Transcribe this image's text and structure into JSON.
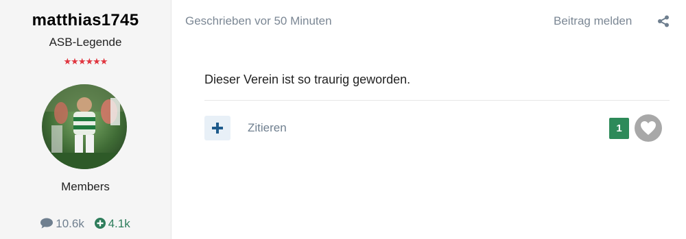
{
  "author": {
    "username": "matthias1745",
    "title": "ASB-Legende",
    "stars": "★★★★★★",
    "group": "Members",
    "post_count": "10.6k",
    "reputation": "4.1k"
  },
  "post": {
    "meta": "Geschrieben vor 50 Minuten",
    "report_label": "Beitrag melden",
    "content": "Dieser Verein ist so traurig geworden.",
    "quote_label": "Zitieren",
    "reaction_count": "1"
  },
  "icons": {
    "share": "share-icon",
    "multiquote": "plus-icon",
    "reaction": "heart-icon",
    "posts": "comment-icon",
    "reputation": "plus-circle-icon"
  },
  "colors": {
    "reaction_badge": "#2d8a59",
    "stars": "#e0353f",
    "muted_text": "#7b8794"
  }
}
